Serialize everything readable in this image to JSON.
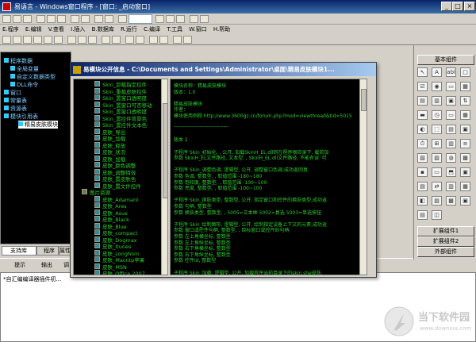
{
  "window": {
    "title": "易语言 - Windows窗口程序 - [窗口: _启动窗口]",
    "min": "_",
    "max": "□",
    "close": "×"
  },
  "menu": [
    "E.程序",
    "E.编辑",
    "V.查看",
    "I.插入",
    "B.数据库",
    "R.运行",
    "C.编译",
    "T.工具",
    "W.窗口",
    "H.帮助"
  ],
  "toolbar_select": "",
  "left_tree": [
    {
      "label": "程序数据",
      "indent": 0
    },
    {
      "label": "全局变量",
      "indent": 1
    },
    {
      "label": "自定义数据类型",
      "indent": 1
    },
    {
      "label": "DLL命令",
      "indent": 1
    },
    {
      "label": "窗口",
      "indent": 0
    },
    {
      "label": "常量表",
      "indent": 0
    },
    {
      "label": "资源表",
      "indent": 0
    },
    {
      "label": "模块引用表",
      "indent": 0
    },
    {
      "label": "精易皮肤模块",
      "indent": 2,
      "selected": true
    }
  ],
  "left_tabs": [
    "支持库",
    "程序",
    "属性"
  ],
  "bottom_tabs": [
    "提示",
    "输出",
    "调"
  ],
  "output_text": "*自汇编编译器插件初...",
  "right_panel": {
    "header": "基本组件",
    "extended1": "扩展组件1",
    "extended2": "扩展组件2",
    "external": "外部组件"
  },
  "dialog": {
    "title": "易模块公开信息 - C:\\Documents and Settings\\Administrator\\桌面\\精易皮肤模块1...",
    "list_items": [
      "Skin_卸载指定控件",
      "Skin_重载皮肤控件",
      "Skin_置窗口透明度",
      "Skin_置窗口可否移动",
      "Skin_置窗口透明度",
      "Skin_置控件背景色",
      "Skin_置控件文本色",
      "皮肤_导出",
      "皮肤_加载",
      "皮肤_释放",
      "皮肤_状况",
      "皮肤_加载",
      "皮肤_颜色调整",
      "皮肤_调整特效",
      "皮肤_置皮肤色",
      "皮肤_置文件控件",
      "图片资源",
      "皮肤_Adamant",
      "皮肤_Ares",
      "皮肤_Asus",
      "皮肤_Black",
      "皮肤_Blue",
      "皮肤_compact",
      "皮肤_Dogmax",
      "皮肤_Itunes",
      "皮肤_Longhorn",
      "皮肤_Macntp苹果",
      "皮肤_MSN",
      "皮肤_Office 2007"
    ],
    "text_lines": [
      "模块名称：精易皮肤模块",
      "版本：1.0",
      "",
      "精易皮肤模块",
      "作者：",
      "模块使用例程 http://www.3600gz.cn/forum.php?mod=viewthread&tid=5015",
      "",
      "--------------------------------",
      "",
      "版本 2",
      "",
      "子程序 Skin_初始化, , 公开, 加载SkinH_EL.dll到在程序根目录下, 载若加",
      "参数 SkinH_EL文件路径, 文本型, , SkinH_EL.dll文件路径, 不能有误 '可",
      "",
      "子程序 Skin_调整色调, 逻辑型, 公开, 调整窗口色调,成功返回真",
      "参数 色调, 整数型, , 取值范围 -180~180",
      "参数 饱和度, 整数型, , 取值范围 -100~100",
      "参数 亮度, 整数型, , 取值范围 -100~100",
      "",
      "子程序 Skin_换肤类型, 整数型, 公开, 指定窗口和控件的换肤类型,成功返",
      "参数 句柄, 整数型",
      "参数 换肤类型, 整数型, , 5005=文本框   5002=复选   5003=单选按钮",
      "",
      "子程序 Skin_绘制图形, 逻辑型, 公开, 绘制指定设备上下文的元素,成功返",
      "参数 窗口或控件句柄, 整数型, , 目标窗口或控件的句柄",
      "参数 左上角横坐标, 整数型",
      "参数 左上角纵坐标, 整数型",
      "参数 右下角横坐标, 整数型",
      "参数 右下角纵坐标, 整数型",
      "参数 控件id, 整数型",
      "",
      "子程序 Skin_加载, 逻辑型, 公开, 加载程序当前目录下的skin.she皮肤,"
    ]
  },
  "watermark": {
    "text": "当下软件园",
    "url": "www.downxia.com"
  }
}
